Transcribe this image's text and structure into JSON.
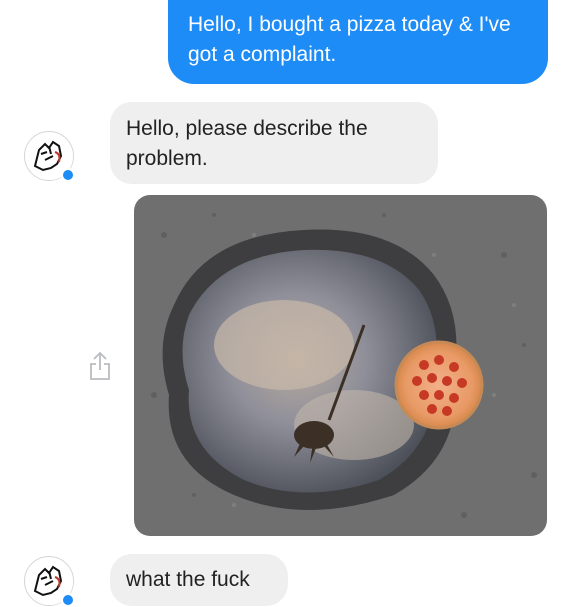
{
  "messages": {
    "outgoing_1": "Hello, I bought a pizza today & I've got a complaint.",
    "incoming_1": "Hello, please describe the problem.",
    "incoming_2": "what the fuck"
  },
  "colors": {
    "outgoing_bubble": "#1e8cf7",
    "incoming_bubble": "#efefef"
  },
  "icons": {
    "avatar": "little-caesars-logo-icon",
    "share": "share-icon",
    "badge": "messenger-badge-icon"
  }
}
